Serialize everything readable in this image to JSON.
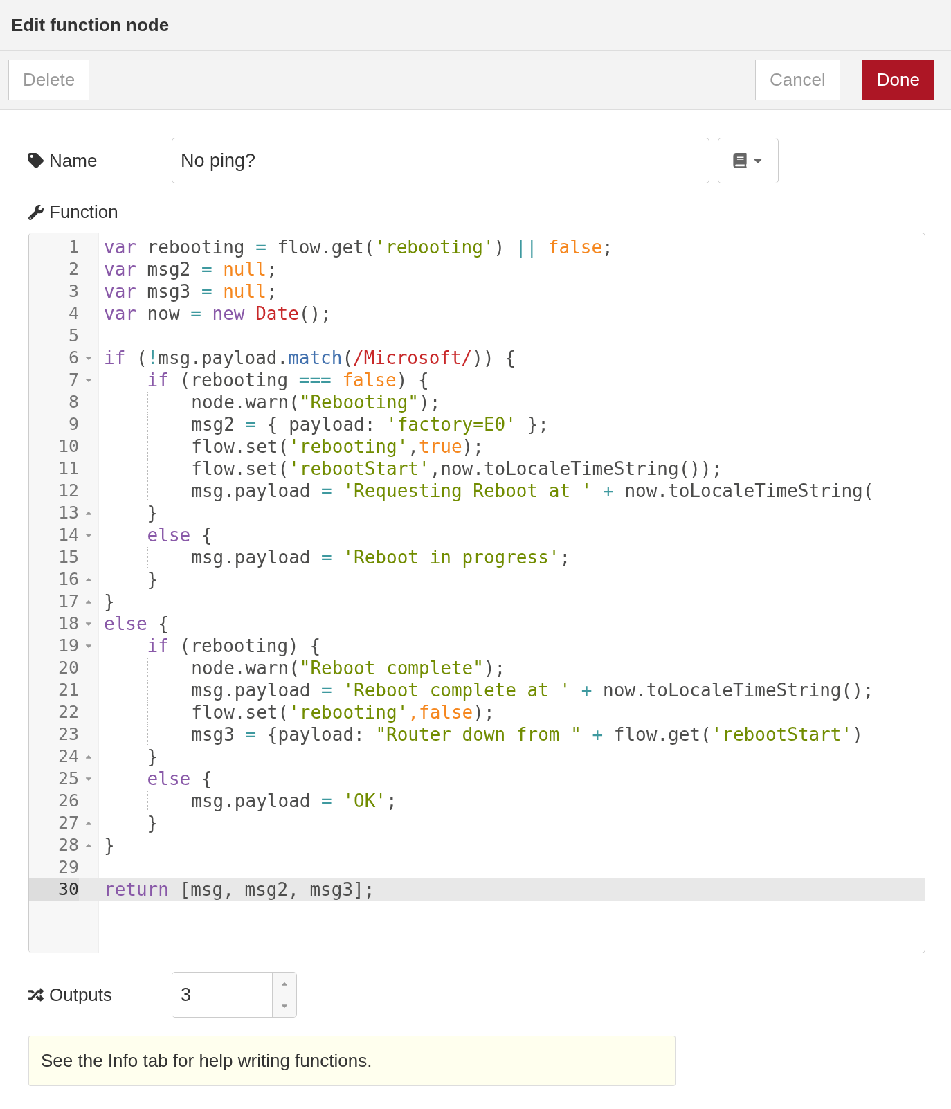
{
  "dialog": {
    "title": "Edit function node"
  },
  "toolbar": {
    "buttons": [
      {
        "label": "Delete",
        "kind": "plain"
      },
      {
        "label": "Cancel",
        "kind": "plain"
      },
      {
        "label": "Done",
        "kind": "primary"
      }
    ]
  },
  "name_field": {
    "label": "Name",
    "value": "No ping?"
  },
  "function_editor": {
    "label": "Function",
    "lines": [
      {
        "number": "1",
        "active": false,
        "tokens": [
          {
            "kind": "keyword",
            "text": "var"
          },
          {
            "kind": "plain",
            "text": " rebooting "
          },
          {
            "kind": "operator",
            "text": "="
          },
          {
            "kind": "plain",
            "text": " flow.get("
          },
          {
            "kind": "string",
            "text": "'rebooting'"
          },
          {
            "kind": "plain",
            "text": ") "
          },
          {
            "kind": "operator",
            "text": "|| "
          },
          {
            "kind": "atom",
            "text": "false"
          },
          {
            "kind": "plain",
            "text": ";"
          }
        ]
      },
      {
        "number": "2",
        "active": false,
        "tokens": [
          {
            "kind": "keyword",
            "text": "var"
          },
          {
            "kind": "plain",
            "text": " msg2 "
          },
          {
            "kind": "operator",
            "text": "= "
          },
          {
            "kind": "atom",
            "text": "null"
          },
          {
            "kind": "plain",
            "text": ";"
          }
        ]
      },
      {
        "number": "3",
        "active": false,
        "tokens": [
          {
            "kind": "keyword",
            "text": "var"
          },
          {
            "kind": "plain",
            "text": " msg3 "
          },
          {
            "kind": "operator",
            "text": "= "
          },
          {
            "kind": "atom",
            "text": "null"
          },
          {
            "kind": "plain",
            "text": ";"
          }
        ]
      },
      {
        "number": "4",
        "active": false,
        "tokens": [
          {
            "kind": "keyword",
            "text": "var"
          },
          {
            "kind": "plain",
            "text": " now "
          },
          {
            "kind": "operator",
            "text": "= "
          },
          {
            "kind": "keyword",
            "text": "new "
          },
          {
            "kind": "builtin",
            "text": "Date"
          },
          {
            "kind": "plain",
            "text": "();"
          }
        ]
      },
      {
        "number": "5",
        "active": false
      },
      {
        "number": "6",
        "active": false,
        "expanded": true,
        "tokens": [
          {
            "kind": "keyword",
            "text": "if"
          },
          {
            "kind": "plain",
            "text": " ("
          },
          {
            "kind": "operator",
            "text": "!"
          },
          {
            "kind": "plain",
            "text": "msg.payload."
          },
          {
            "kind": "function",
            "text": "match"
          },
          {
            "kind": "plain",
            "text": "("
          },
          {
            "kind": "builtin",
            "text": "/Microsoft/"
          },
          {
            "kind": "plain",
            "text": ")) {"
          }
        ]
      },
      {
        "number": "7",
        "active": false,
        "expanded": true,
        "tokens": [
          {
            "kind": "keyword",
            "text": "    if"
          },
          {
            "kind": "plain",
            "text": " (rebooting "
          },
          {
            "kind": "operator",
            "text": "=== "
          },
          {
            "kind": "atom",
            "text": "false"
          },
          {
            "kind": "plain",
            "text": ") {"
          }
        ]
      },
      {
        "number": "8",
        "active": false,
        "tokens": [
          {
            "kind": "plain",
            "text": "        node.warn("
          },
          {
            "kind": "string",
            "text": "\"Rebooting\""
          },
          {
            "kind": "plain",
            "text": ");"
          }
        ]
      },
      {
        "number": "9",
        "active": false,
        "tokens": [
          {
            "kind": "plain",
            "text": "        msg2 "
          },
          {
            "kind": "operator",
            "text": "="
          },
          {
            "kind": "plain",
            "text": " { payload: "
          },
          {
            "kind": "string",
            "text": "'factory=E0'"
          },
          {
            "kind": "plain",
            "text": " };"
          }
        ]
      },
      {
        "number": "10",
        "active": false,
        "tokens": [
          {
            "kind": "plain",
            "text": "        flow.set("
          },
          {
            "kind": "string",
            "text": "'rebooting'"
          },
          {
            "kind": "plain",
            "text": ","
          },
          {
            "kind": "atom",
            "text": "true"
          },
          {
            "kind": "plain",
            "text": ");"
          }
        ]
      },
      {
        "number": "11",
        "active": false,
        "tokens": [
          {
            "kind": "plain",
            "text": "        flow.set("
          },
          {
            "kind": "string",
            "text": "'rebootStart'"
          },
          {
            "kind": "plain",
            "text": ",now.toLocaleTimeString());"
          }
        ]
      },
      {
        "number": "12",
        "active": false,
        "tokens": [
          {
            "kind": "plain",
            "text": "        msg.payload "
          },
          {
            "kind": "operator",
            "text": "= "
          },
          {
            "kind": "string",
            "text": "'Requesting Reboot at '"
          },
          {
            "kind": "operator",
            "text": " +"
          },
          {
            "kind": "plain",
            "text": " now.toLocaleTimeString("
          }
        ]
      },
      {
        "number": "13",
        "active": false,
        "fold_end": true,
        "tokens": [
          {
            "kind": "plain",
            "text": "    }"
          }
        ]
      },
      {
        "number": "14",
        "active": false,
        "expanded": true,
        "tokens": [
          {
            "kind": "keyword",
            "text": "    else"
          },
          {
            "kind": "plain",
            "text": " {"
          }
        ]
      },
      {
        "number": "15",
        "active": false,
        "tokens": [
          {
            "kind": "plain",
            "text": "        msg.payload "
          },
          {
            "kind": "operator",
            "text": "= "
          },
          {
            "kind": "string",
            "text": "'Reboot in progress'"
          },
          {
            "kind": "plain",
            "text": ";"
          }
        ]
      },
      {
        "number": "16",
        "active": false,
        "fold_end": true,
        "tokens": [
          {
            "kind": "plain",
            "text": "    }"
          }
        ]
      },
      {
        "number": "17",
        "active": false,
        "fold_end": true,
        "tokens": [
          {
            "kind": "plain",
            "text": "}"
          }
        ]
      },
      {
        "number": "18",
        "active": false,
        "expanded": true,
        "tokens": [
          {
            "kind": "keyword",
            "text": "else"
          },
          {
            "kind": "plain",
            "text": " {"
          }
        ]
      },
      {
        "number": "19",
        "active": false,
        "expanded": true,
        "tokens": [
          {
            "kind": "keyword",
            "text": "    if"
          },
          {
            "kind": "plain",
            "text": " (rebooting) {"
          }
        ]
      },
      {
        "number": "20",
        "active": false,
        "tokens": [
          {
            "kind": "plain",
            "text": "        node.warn("
          },
          {
            "kind": "string",
            "text": "\"Reboot complete\""
          },
          {
            "kind": "plain",
            "text": ");"
          }
        ]
      },
      {
        "number": "21",
        "active": false,
        "tokens": [
          {
            "kind": "plain",
            "text": "        msg.payload "
          },
          {
            "kind": "operator",
            "text": "= "
          },
          {
            "kind": "string",
            "text": "'Reboot complete at '"
          },
          {
            "kind": "operator",
            "text": " +"
          },
          {
            "kind": "plain",
            "text": " now.toLocaleTimeString();"
          }
        ]
      },
      {
        "number": "22",
        "active": false,
        "tokens": [
          {
            "kind": "plain",
            "text": "        flow.set("
          },
          {
            "kind": "string",
            "text": "'rebooting'"
          },
          {
            "kind": "atom",
            "text": ",false"
          },
          {
            "kind": "plain",
            "text": ");"
          }
        ]
      },
      {
        "number": "23",
        "active": false,
        "tokens": [
          {
            "kind": "plain",
            "text": "        msg3 "
          },
          {
            "kind": "operator",
            "text": "="
          },
          {
            "kind": "plain",
            "text": " {payload: "
          },
          {
            "kind": "string",
            "text": "\"Router down from \""
          },
          {
            "kind": "operator",
            "text": " +"
          },
          {
            "kind": "plain",
            "text": " flow.get("
          },
          {
            "kind": "string",
            "text": "'rebootStart'"
          },
          {
            "kind": "plain",
            "text": ")"
          }
        ]
      },
      {
        "number": "24",
        "active": false,
        "fold_end": true,
        "tokens": [
          {
            "kind": "plain",
            "text": "    }"
          }
        ]
      },
      {
        "number": "25",
        "active": false,
        "expanded": true,
        "tokens": [
          {
            "kind": "keyword",
            "text": "    else"
          },
          {
            "kind": "plain",
            "text": " {"
          }
        ]
      },
      {
        "number": "26",
        "active": false,
        "tokens": [
          {
            "kind": "plain",
            "text": "        msg.payload "
          },
          {
            "kind": "operator",
            "text": "= "
          },
          {
            "kind": "string",
            "text": "'OK'"
          },
          {
            "kind": "plain",
            "text": ";"
          }
        ]
      },
      {
        "number": "27",
        "active": false,
        "fold_end": true,
        "tokens": [
          {
            "kind": "plain",
            "text": "    }"
          }
        ]
      },
      {
        "number": "28",
        "active": false,
        "fold_end": true,
        "tokens": [
          {
            "kind": "plain",
            "text": "}"
          }
        ]
      },
      {
        "number": "29",
        "active": false
      },
      {
        "number": "30",
        "active": true,
        "tokens": [
          {
            "kind": "keyword",
            "text": "return"
          },
          {
            "kind": "plain",
            "text": " [msg, msg2, msg3];"
          }
        ]
      }
    ]
  },
  "outputs_field": {
    "label": "Outputs",
    "value": "3"
  },
  "tip": {
    "text": "See the Info tab for help writing functions."
  }
}
